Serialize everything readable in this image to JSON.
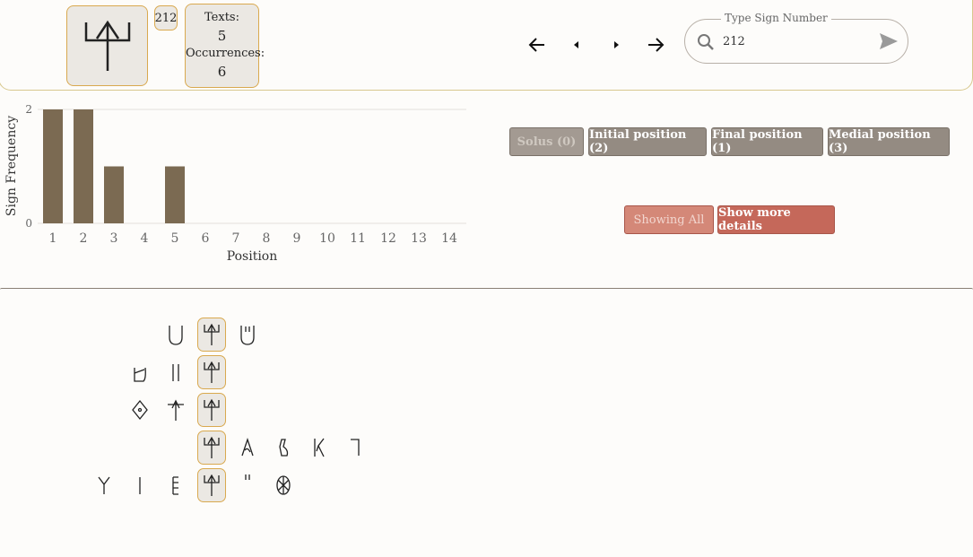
{
  "header": {
    "sign_number": "212",
    "texts_label": "Texts:",
    "texts_count": "5",
    "occurrences_label": "Occurrences:",
    "occurrences_count": "6",
    "nav": {
      "first_icon": "arrow-left-icon",
      "prev_icon": "caret-left-icon",
      "next_icon": "caret-right-icon",
      "last_icon": "arrow-right-icon"
    },
    "search": {
      "legend": "Type Sign Number",
      "value": "212",
      "search_icon": "search-icon",
      "send_icon": "send-icon"
    }
  },
  "chart_data": {
    "type": "bar",
    "categories": [
      "1",
      "2",
      "3",
      "4",
      "5",
      "6",
      "7",
      "8",
      "9",
      "10",
      "11",
      "12",
      "13",
      "14"
    ],
    "values": [
      2,
      2,
      1,
      0,
      1,
      0,
      0,
      0,
      0,
      0,
      0,
      0,
      0,
      0
    ],
    "xlabel": "Position",
    "ylabel": "Sign Frequency",
    "ylim": [
      0,
      2
    ],
    "yticks": [
      "0",
      "2"
    ],
    "bar_color": "#7b6a52",
    "grid": true
  },
  "filters": {
    "solus": "Solus (0)",
    "initial": "Initial position (2)",
    "final": "Final position (1)",
    "medial": "Medial position (3)"
  },
  "actions": {
    "showing_all": "Showing All",
    "more_details": "Show more details"
  },
  "colors": {
    "accent": "#d9a94f",
    "bar": "#7b6a52",
    "filter_button": "#948b82",
    "action_button": "#c5685a"
  }
}
